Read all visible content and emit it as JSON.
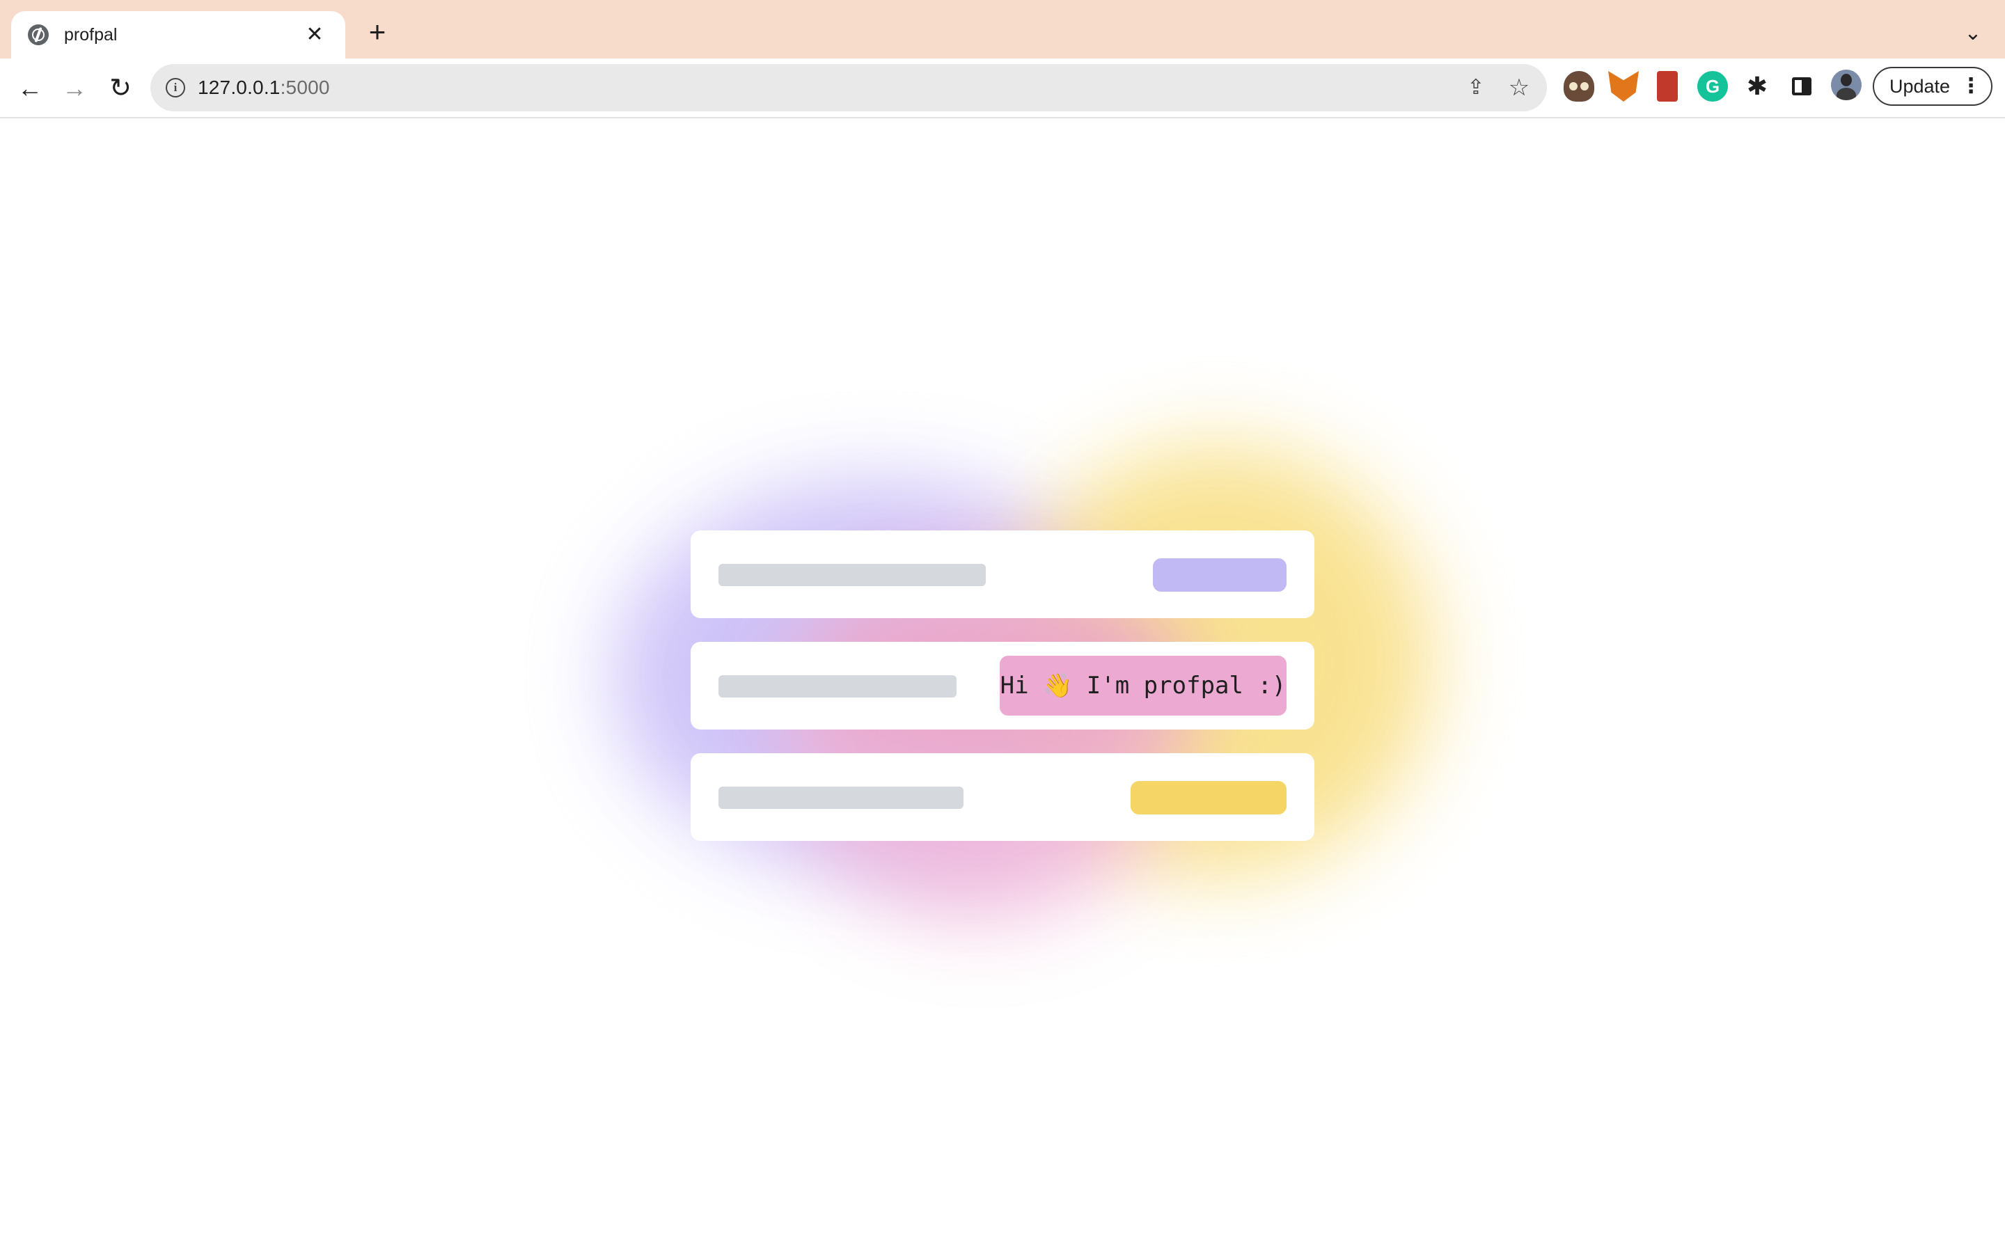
{
  "browser": {
    "tab": {
      "title": "profpal",
      "close_glyph": "✕"
    },
    "new_tab_glyph": "+",
    "tab_list_glyph": "⌄",
    "nav": {
      "back": "←",
      "forward": "→",
      "reload": "↻"
    },
    "address": {
      "host": "127.0.0.1",
      "port": ":5000",
      "info_glyph": "i"
    },
    "omnibox_icons": {
      "share": "⇪",
      "star": "☆"
    },
    "extensions": [
      "owl-icon",
      "metamask-fox-icon",
      "book-icon",
      "grammarly-icon",
      "puzzle-icon",
      "side-panel-icon"
    ],
    "grammarly_glyph": "G",
    "puzzle_glyph": "✱",
    "update_button": {
      "label": "Update",
      "menu_glyph": "⋮"
    }
  },
  "page": {
    "greeting": "Hi 👋 I'm profpal :)",
    "colors": {
      "purple": "#c1b9f4",
      "pink": "#ecaad2",
      "yellow": "#f4d565",
      "placeholder": "#d5d8dc",
      "tabstrip": "#f8dccb"
    }
  }
}
